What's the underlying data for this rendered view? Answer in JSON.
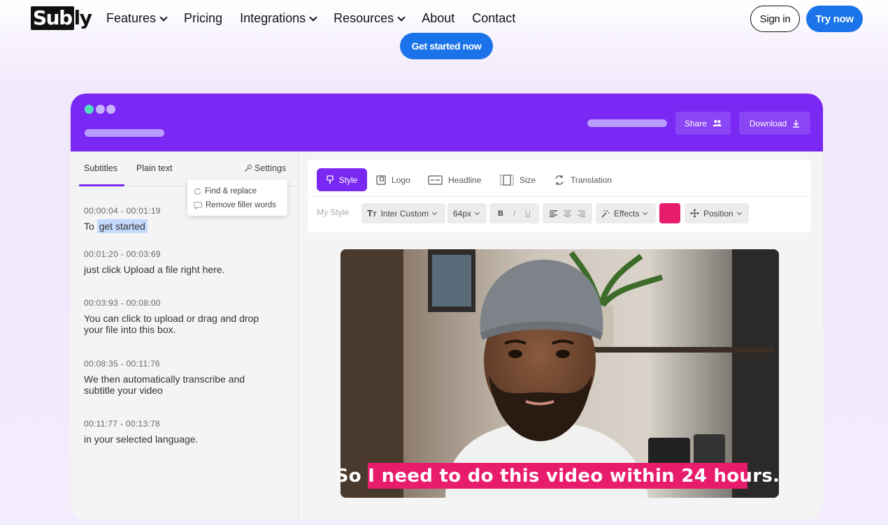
{
  "nav": {
    "logo_part1": "Sub",
    "logo_part2": "ly",
    "links": [
      "Features",
      "Pricing",
      "Integrations",
      "Resources",
      "About",
      "Contact"
    ],
    "sign_in": "Sign in",
    "try_now": "Try now"
  },
  "hero": {
    "cta": "Get started now"
  },
  "app": {
    "header": {
      "share": "Share",
      "download": "Download"
    },
    "left": {
      "tabs": [
        "Subtitles",
        "Plain text"
      ],
      "settings": "Settings",
      "menu": [
        "Find & replace",
        "Remove filler words"
      ],
      "subtitles": [
        {
          "time": "00:00:04 - 00:01:19",
          "text_before": "To ",
          "text_highlight": "get started"
        },
        {
          "time": "00:01:20 - 00:03:69",
          "text": "just click Upload a file right here."
        },
        {
          "time": "00:03:93 - 00:08:00",
          "text": "You can click to upload or drag and drop your file into this box."
        },
        {
          "time": "00:08:35 - 00:11:76",
          "text": "We then automatically transcribe and subtitle your video"
        },
        {
          "time": "00:11:77 - 00:13:78",
          "text": "in your selected language."
        }
      ]
    },
    "toolbar": {
      "tabs": [
        "Style",
        "Logo",
        "Headline",
        "Size",
        "Translation"
      ],
      "my_style": "My Style",
      "font": "Inter Custom",
      "font_size": "64px",
      "bold": "B",
      "italic": "I",
      "underline": "U",
      "effects": "Effects",
      "position": "Position",
      "caption_color": "#e81c6c"
    },
    "video": {
      "caption": "So I need to do this video within 24 hours."
    }
  },
  "colors": {
    "brand_purple": "#7a28f4",
    "cta_blue": "#1a73e8"
  }
}
